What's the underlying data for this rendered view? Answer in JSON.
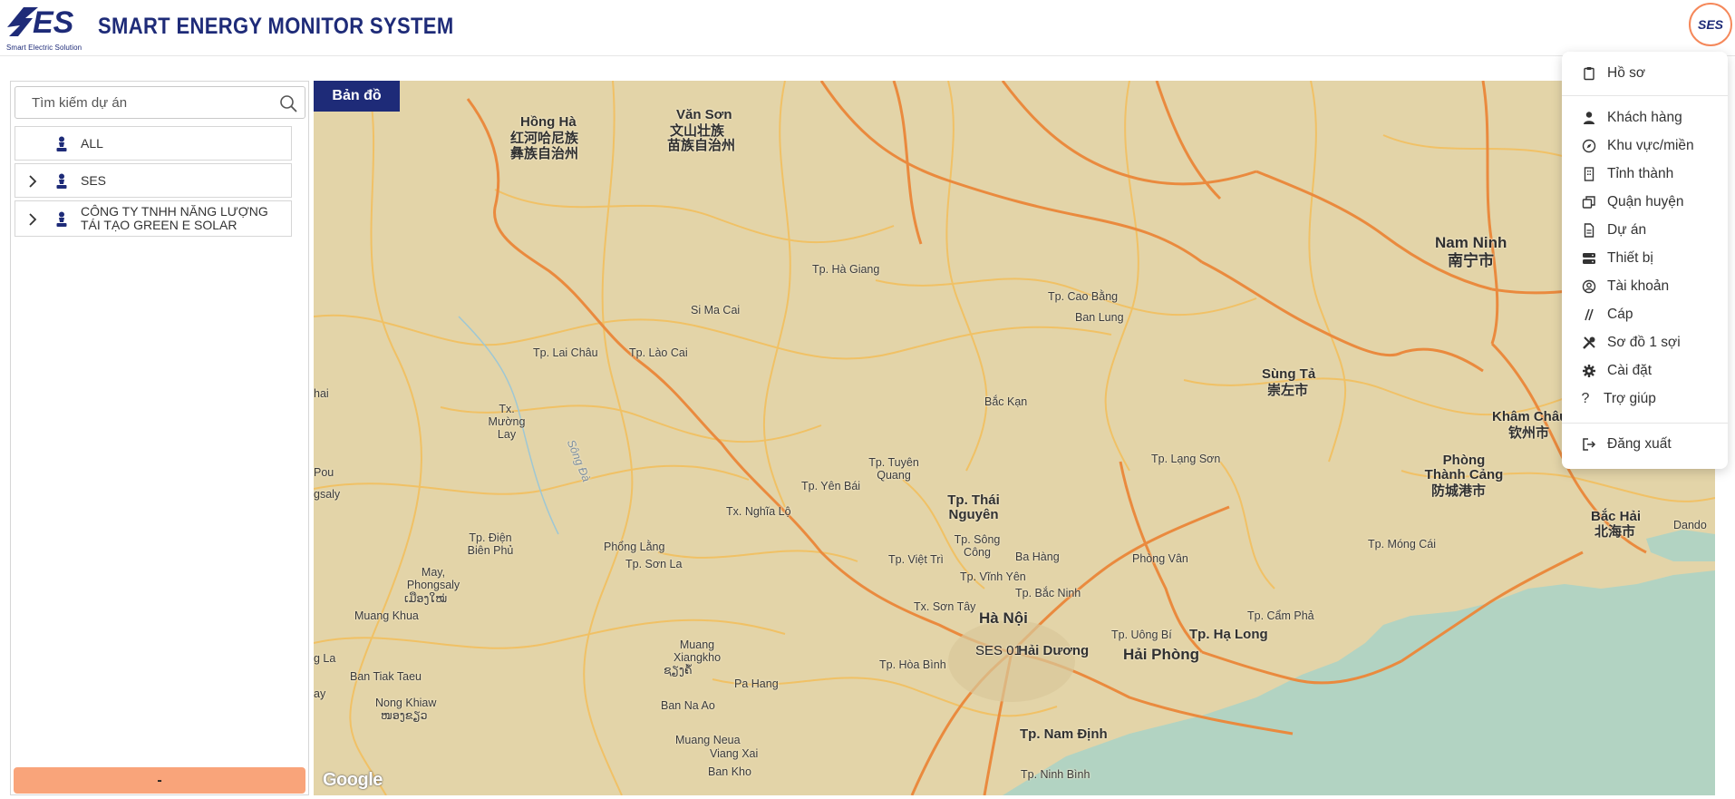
{
  "header": {
    "logo_text": "SES",
    "logo_subtitle": "Smart Electric Solution",
    "title": "SMART ENERGY MONITOR SYSTEM",
    "avatar_text": "SES"
  },
  "sidebar": {
    "search_placeholder": "Tìm kiếm dự án",
    "tree": [
      {
        "label": "ALL",
        "expandable": false
      },
      {
        "label": "SES",
        "expandable": true
      },
      {
        "label": "CÔNG TY TNHH NĂNG LƯỢNG TÁI TẠO GREEN E SOLAR",
        "expandable": true
      }
    ],
    "footer_button": "-"
  },
  "map": {
    "tab_label": "Bản đồ",
    "attribution": "Google",
    "marker_label": "SES 01",
    "labels": {
      "hong_ha": "Hồng Hà",
      "hong_ha_cn1": "红河哈尼族",
      "hong_ha_cn2": "彝族自治州",
      "van_son": "Văn Sơn",
      "van_son_cn1": "文山壮族",
      "van_son_cn2": "苗族自治州",
      "nam_ninh": "Nam Ninh",
      "nam_ninh_cn": "南宁市",
      "ha_giang": "Tp. Hà Giang",
      "si_ma_cai": "Si Ma Cai",
      "cao_bang": "Tp. Cao Bằng",
      "ban_lung": "Ban Lung",
      "lai_chau": "Tp. Lai Châu",
      "lao_cai": "Tp. Lào Cai",
      "sung_ta": "Sùng Tả",
      "sung_ta_cn": "崇左市",
      "hai": "hai",
      "muong_lay": "Tx. Mường Lay",
      "bac_kan": "Bắc Kạn",
      "kham_chau": "Khâm Châu",
      "kham_chau_cn": "钦州市",
      "song_da": "Sông Đà",
      "tuyen_quang": "Tp. Tuyên Quang",
      "lang_son": "Tp. Lạng Sơn",
      "pou": "Pou",
      "gsaly": "gsaly",
      "yen_bai": "Tp. Yên Bái",
      "thai_nguyen": "Tp. Thái Nguyên",
      "phong_thanh_cang": "Phòng Thành Cảng",
      "phong_thanh_cang_cn": "防城港市",
      "nghia_lo": "Tx. Nghĩa Lộ",
      "bac_hai": "Bắc Hải",
      "bac_hai_cn": "北海市",
      "dien_bien": "Tp. Điện Biên Phủ",
      "phong_lang": "Phổng Lằng",
      "song_cong": "Tp. Sông Công",
      "ba_hang": "Ba Hàng",
      "phong_van": "Phòng Vân",
      "mong_cai": "Tp. Móng Cái",
      "viet_tri": "Tp. Việt Trì",
      "son_la": "Tp. Sơn La",
      "may_phongsaly": "May, Phongsaly",
      "may_lao": "ເມືອງໃໝ່",
      "vinh_yen": "Tp. Vĩnh Yên",
      "bac_ninh": "Tp. Bắc Ninh",
      "muang_khua": "Muang Khua",
      "son_tay": "Tx. Sơn Tây",
      "ha_noi": "Hà Nội",
      "cam_pha": "Tp. Cẩm Phả",
      "uong_bi": "Tp. Uông Bí",
      "ha_long": "Tp. Hạ Long",
      "hai_duong": "Hải Dương",
      "hai_phong": "Hải Phòng",
      "muang_xiangkho": "Muang Xiangkho",
      "xiangkho_lao": "ຊຽງຄໍ້",
      "g_la": "g La",
      "hoa_binh": "Tp. Hòa Bình",
      "ban_tiak_taeu": "Ban Tiak Taeu",
      "pa_hang": "Pa Hang",
      "ay": "ay",
      "nong_khiaw": "Nong Khiaw",
      "nong_khiaw_lao": "ໜອງຂຽວ",
      "ban_na_ao": "Ban Na Ao",
      "nam_dinh": "Tp. Nam Định",
      "muang_neua": "Muang Neua",
      "viang_xai": "Viang Xai",
      "ban_kho": "Ban Kho",
      "ninh_binh": "Tp. Ninh Bình",
      "dando": "Dando"
    }
  },
  "menu": {
    "items": [
      {
        "label": "Hồ sơ",
        "icon": "clipboard-icon"
      },
      {
        "label": "Khách hàng",
        "icon": "user-icon"
      },
      {
        "label": "Khu vực/miền",
        "icon": "compass-icon"
      },
      {
        "label": "Tỉnh thành",
        "icon": "building-icon"
      },
      {
        "label": "Quận huyện",
        "icon": "copy-icon"
      },
      {
        "label": "Dự án",
        "icon": "file-icon"
      },
      {
        "label": "Thiết bị",
        "icon": "server-icon"
      },
      {
        "label": "Tài khoản",
        "icon": "user-circle-icon"
      },
      {
        "label": "Cáp",
        "icon": "cable-icon"
      },
      {
        "label": "Sơ đồ 1 sợi",
        "icon": "tools-icon"
      },
      {
        "label": "Cài đặt",
        "icon": "gear-icon"
      },
      {
        "label": "Trợ giúp",
        "icon": "question-icon"
      },
      {
        "label": "Đăng xuất",
        "icon": "logout-icon"
      }
    ]
  },
  "colors": {
    "brand": "#1e2b78",
    "accent": "#f9a47a",
    "avatar_border": "#f5885a",
    "map_land": "#e3d4a8",
    "map_sea": "#b2d3c2",
    "road_major": "#ea8a3e",
    "road_minor": "#f2bf5e"
  }
}
